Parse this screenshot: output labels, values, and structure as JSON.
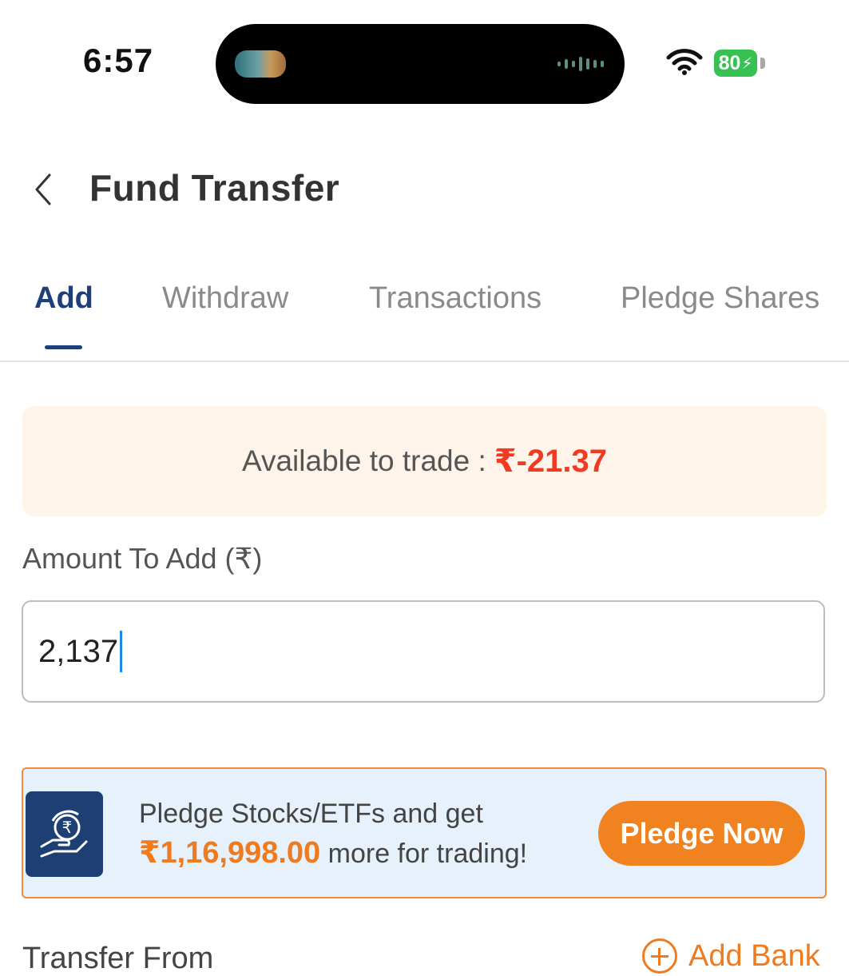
{
  "status_bar": {
    "time": "6:57",
    "battery": "80",
    "icons": [
      "now-playing-thumbnail",
      "audio-wave-icon",
      "wifi-icon",
      "battery-icon"
    ]
  },
  "header": {
    "back_icon": "chevron-left-icon",
    "title": "Fund Transfer"
  },
  "tabs": [
    {
      "label": "Add",
      "active": true
    },
    {
      "label": "Withdraw",
      "active": false
    },
    {
      "label": "Transactions",
      "active": false
    },
    {
      "label": "Pledge Shares",
      "active": false
    }
  ],
  "available": {
    "label": "Available to trade :",
    "value": "₹-21.37"
  },
  "amount": {
    "label": "Amount To Add (₹)",
    "value": "2,137"
  },
  "pledge": {
    "line1": "Pledge Stocks/ETFs and get",
    "amount": "₹1,16,998.00",
    "line2_suffix": "more for trading!",
    "button": "Pledge Now",
    "icon": "rupee-hand-refresh-icon"
  },
  "transfer": {
    "label": "Transfer From",
    "add_bank": "Add Bank"
  },
  "colors": {
    "brand_blue": "#1f3f7a",
    "accent_orange": "#f0821f",
    "negative_red": "#ef3b22",
    "available_bg": "#fef4ea",
    "pledge_bg": "#e6f1fb"
  }
}
